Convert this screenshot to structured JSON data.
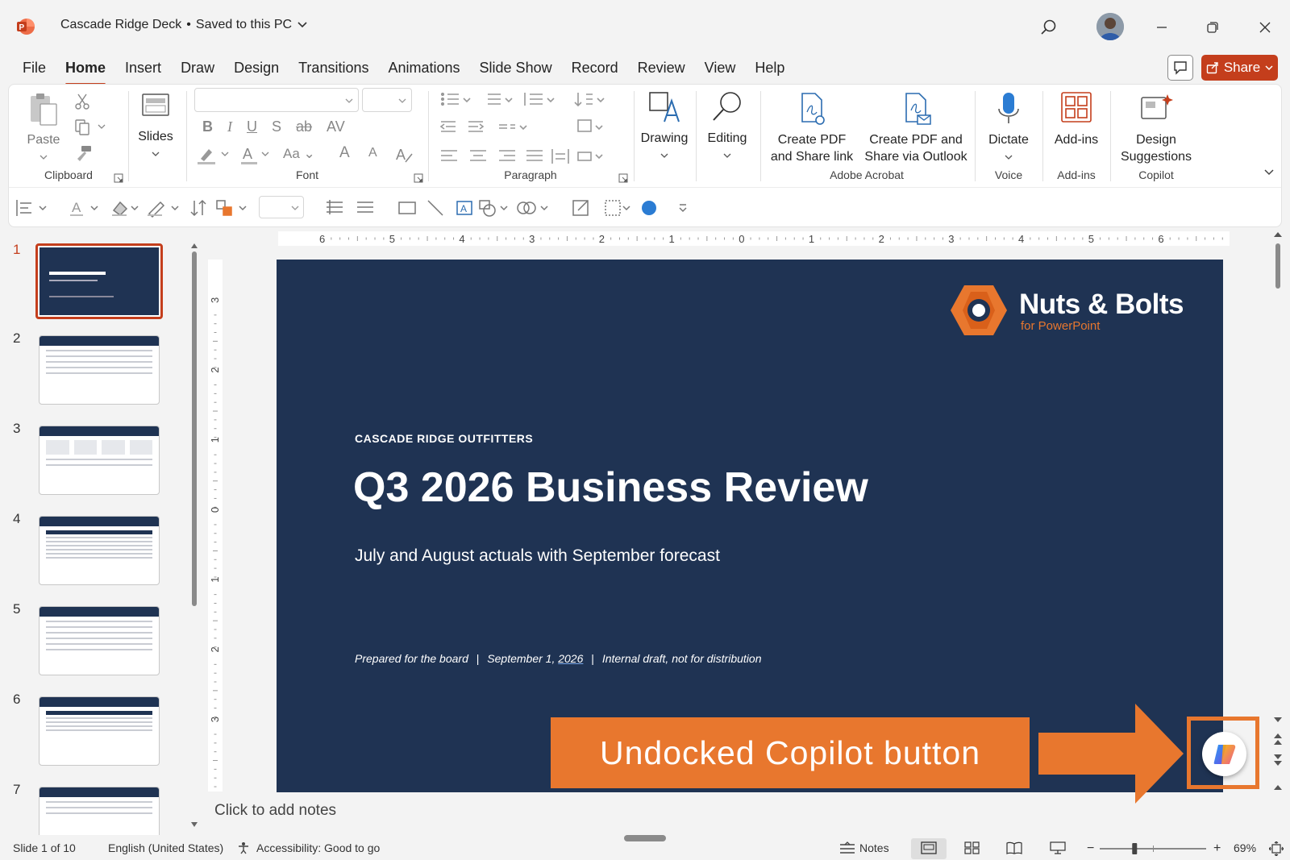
{
  "window": {
    "doc_title": "Cascade Ridge Deck",
    "save_status": "Saved to this PC"
  },
  "menu": {
    "tabs": [
      {
        "label": "File",
        "active": false
      },
      {
        "label": "Home",
        "active": true
      },
      {
        "label": "Insert",
        "active": false
      },
      {
        "label": "Draw",
        "active": false
      },
      {
        "label": "Design",
        "active": false
      },
      {
        "label": "Transitions",
        "active": false
      },
      {
        "label": "Animations",
        "active": false
      },
      {
        "label": "Slide Show",
        "active": false
      },
      {
        "label": "Record",
        "active": false
      },
      {
        "label": "Review",
        "active": false
      },
      {
        "label": "View",
        "active": false
      },
      {
        "label": "Help",
        "active": false
      }
    ],
    "share_label": "Share"
  },
  "ribbon": {
    "clipboard": {
      "paste_label": "Paste",
      "group_label": "Clipboard"
    },
    "slides": {
      "label": "Slides"
    },
    "font": {
      "group_label": "Font",
      "bold": "B",
      "italic": "I",
      "underline": "U",
      "shadow": "S",
      "strike": "ab",
      "spacing": "AV",
      "case": "Aa",
      "grow": "A",
      "shrink": "A"
    },
    "paragraph": {
      "group_label": "Paragraph"
    },
    "drawing": {
      "label": "Drawing"
    },
    "editing": {
      "label": "Editing"
    },
    "acrobat": {
      "create_pdf_line1": "Create PDF",
      "create_pdf_line2": "and Share link",
      "pdf_outlook_line1": "Create PDF and",
      "pdf_outlook_line2": "Share via Outlook",
      "group_label": "Adobe Acrobat"
    },
    "voice": {
      "dictate_label": "Dictate",
      "group_label": "Voice"
    },
    "addins": {
      "label": "Add-ins",
      "group_label": "Add-ins"
    },
    "copilot": {
      "line1": "Design",
      "line2": "Suggestions",
      "group_label": "Copilot"
    }
  },
  "thumbnails": {
    "numbers": [
      "1",
      "2",
      "3",
      "4",
      "5",
      "6",
      "7"
    ],
    "selected": "1"
  },
  "ruler": {
    "h_labels": [
      "6",
      "5",
      "4",
      "3",
      "2",
      "1",
      "0",
      "1",
      "2",
      "3",
      "4",
      "5",
      "6"
    ],
    "v_labels": [
      "3",
      "2",
      "1",
      "0",
      "1",
      "2",
      "3"
    ]
  },
  "slide": {
    "eyebrow": "CASCADE RIDGE OUTFITTERS",
    "title": "Q3 2026 Business Review",
    "subtitle": "July and August actuals with September forecast",
    "footer_part1": "Prepared for the board",
    "footer_sep": "|",
    "footer_part2_pre": "September 1, ",
    "footer_year": "2026",
    "footer_part3": "Internal draft, not for distribution",
    "logo_name": "Nuts & Bolts",
    "logo_sub": "for PowerPoint",
    "colors": {
      "background": "#1f3353",
      "accent": "#e8772e"
    }
  },
  "callout": {
    "text": "Undocked Copilot button"
  },
  "notes": {
    "placeholder": "Click to add notes"
  },
  "status": {
    "slide_count": "Slide 1 of 10",
    "language": "English (United States)",
    "accessibility": "Accessibility: Good to go",
    "notes_label": "Notes",
    "zoom_label": "69%",
    "zoom_value": 69
  }
}
